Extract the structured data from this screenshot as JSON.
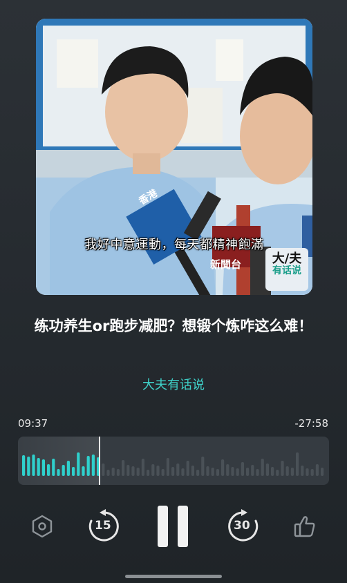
{
  "cover": {
    "subtitle": "我好中意運動，每天都精神飽滿",
    "mic_cube_text": "香港",
    "mic_tag": "新聞台",
    "badge_line1": "大/夫",
    "badge_line2": "有话说"
  },
  "episode": {
    "title": "练功养生or跑步减肥？想锻个炼咋这么难！",
    "author": "大夫有话说"
  },
  "player": {
    "elapsed": "09:37",
    "remaining": "-27:58",
    "progress": 0.259,
    "skip_back_seconds": "15",
    "skip_forward_seconds": "30",
    "state": "playing",
    "accent_color": "#2fd0cc"
  }
}
